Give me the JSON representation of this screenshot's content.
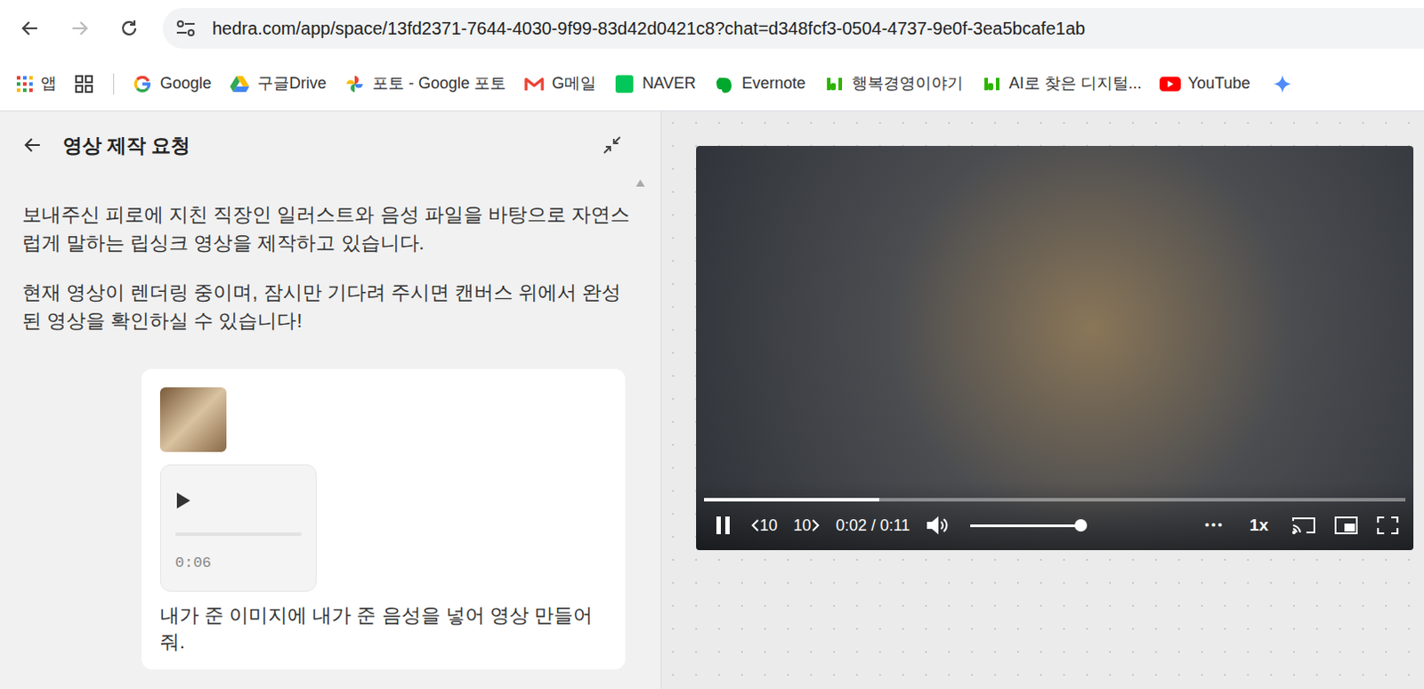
{
  "browser": {
    "url": "hedra.com/app/space/13fd2371-7644-4030-9f99-83d42d0421c8?chat=d348fcf3-0504-4737-9e0f-3ea5bcafe1ab",
    "apps_label": "앱",
    "bookmarks": [
      "Google",
      "구글Drive",
      "포토 - Google 포토",
      "G메일",
      "NAVER",
      "Evernote",
      "행복경영이야기",
      "AI로 찾은 디지털...",
      "YouTube"
    ]
  },
  "chat": {
    "title": "영상 제작 요청",
    "messages": [
      "보내주신 피로에 지친 직장인 일러스트와 음성 파일을 바탕으로 자연스럽게 말하는 립싱크 영상을 제작하고 있습니다.",
      "현재 영상이 렌더링 중이며, 잠시만 기다려 주시면 캔버스 위에서 완성된 영상을 확인하실 수 있습니다!"
    ],
    "request": {
      "audio_duration": "0:06",
      "text": "내가 준 이미지에 내가 준 음성을 넣어 영상 만들어줘."
    }
  },
  "player": {
    "playing": true,
    "rewind": "10",
    "forward": "10",
    "time": "0:02 / 0:11",
    "progress": 0.25,
    "volume": 1.0,
    "more": "⋯",
    "speed": "1x"
  }
}
